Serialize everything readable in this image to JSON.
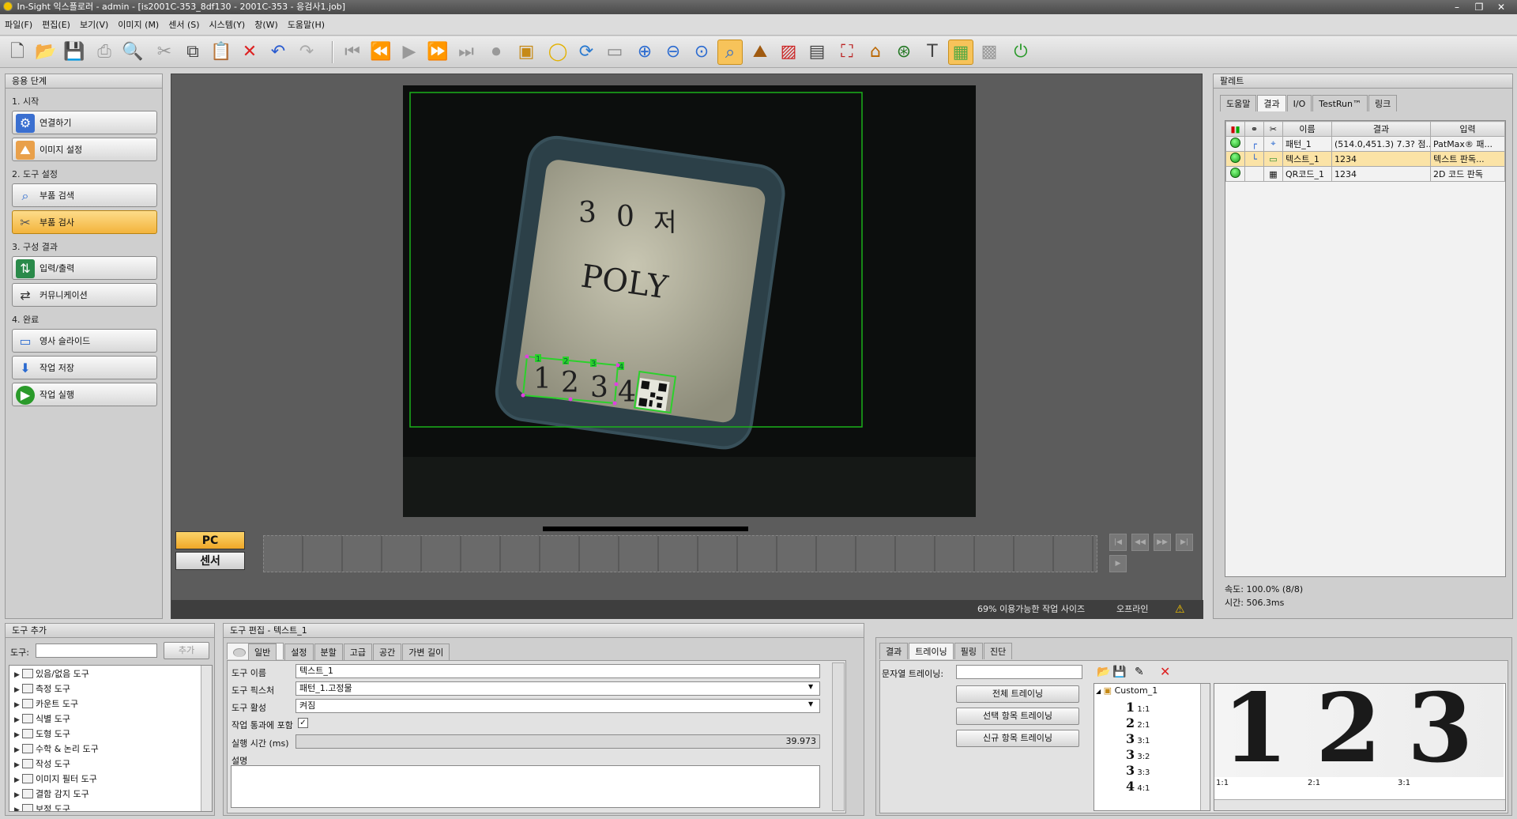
{
  "window": {
    "title": "In-Sight 익스플로러 - admin - [is2001C-353_8df130 - 2001C-353 - 응검사1.job]",
    "controls": [
      "–",
      "❐",
      "✕"
    ]
  },
  "menu": [
    "파일(F)",
    "편집(E)",
    "보기(V)",
    "이미지 (M)",
    "센서 (S)",
    "시스템(Y)",
    "창(W)",
    "도움말(H)"
  ],
  "left_panel": {
    "title": "응용 단계",
    "sections": [
      {
        "label": "1. 시작",
        "items": [
          "연결하기",
          "이미지 설정"
        ]
      },
      {
        "label": "2. 도구 설정",
        "items": [
          "부품 검색",
          "부품 검사"
        ]
      },
      {
        "label": "3. 구성 결과",
        "items": [
          "입력/출력",
          "커뮤니케이션"
        ]
      },
      {
        "label": "4. 완료",
        "items": [
          "영사 슬라이드",
          "작업 저장",
          "작업 실행"
        ]
      }
    ],
    "active_item": "부품 검사"
  },
  "viewer": {
    "image_text": {
      "line1": [
        "3",
        "0",
        "저"
      ],
      "poly": "POLY",
      "digits": [
        "1",
        "2",
        "3",
        "4"
      ],
      "roi_markers": [
        "1",
        "2",
        "3",
        "4"
      ]
    },
    "pc_button": "PC",
    "sensor_button": "센서",
    "status_text": "69% 이용가능한 작업 사이즈",
    "status_mode": "오프라인"
  },
  "palette": {
    "title": "팔레트",
    "tabs": [
      "도움말",
      "결과",
      "I/O",
      "TestRun™",
      "링크"
    ],
    "active_tab": "결과",
    "columns": [
      "이름",
      "결과",
      "입력"
    ],
    "rows": [
      {
        "name": "패턴_1",
        "result": "(514.0,451.3)  7.3? 점...",
        "input": "PatMax® 패...",
        "selected": false
      },
      {
        "name": "텍스트_1",
        "result": "1234",
        "input": "텍스트 판독...",
        "selected": true
      },
      {
        "name": "QR코드_1",
        "result": "1234",
        "input": "2D 코드 판독",
        "selected": false
      }
    ],
    "speed": "속도: 100.0% (8/8)",
    "time": "시간: 506.3ms"
  },
  "tool_add": {
    "title": "도구 추가",
    "label": "도구:",
    "button": "추가",
    "items": [
      "있음/없음 도구",
      "측정 도구",
      "카운트 도구",
      "식별 도구",
      "도형 도구",
      "수학 & 논리 도구",
      "작성 도구",
      "이미지 필터 도구",
      "결함 감지 도구",
      "보정 도구"
    ]
  },
  "tool_edit": {
    "title": "도구 편집 - 텍스트_1",
    "tabs": [
      "일반",
      "설정",
      "분할",
      "고급",
      "공간",
      "가변 길이"
    ],
    "active_tab": "일반",
    "fields": {
      "name_label": "도구 이름",
      "name_value": "텍스트_1",
      "fixture_label": "도구 픽스처",
      "fixture_value": "패턴_1.고정물",
      "enable_label": "도구 활성",
      "enable_value": "켜짐",
      "include_label": "작업 통과에 포함",
      "exec_label": "실행 시간 (ms)",
      "exec_value": "39.973",
      "desc_label": "설명"
    }
  },
  "training": {
    "tabs": [
      "결과",
      "트레이닝",
      "필링",
      "진단"
    ],
    "active_tab": "트레이닝",
    "string_label": "문자열 트레이닝:",
    "buttons": [
      "전체 트레이닝",
      "선택 항목 트레이닝",
      "신규 항목 트레이닝"
    ],
    "font_root": "Custom_1",
    "font_items": [
      {
        "glyph": "1",
        "label": "1:1"
      },
      {
        "glyph": "2",
        "label": "2:1"
      },
      {
        "glyph": "3",
        "label": "3:1"
      },
      {
        "glyph": "3",
        "label": "3:2"
      },
      {
        "glyph": "3",
        "label": "3:3"
      },
      {
        "glyph": "4",
        "label": "4:1"
      }
    ],
    "preview_chars": [
      "1",
      "2",
      "3"
    ],
    "preview_labels": [
      "1:1",
      "2:1",
      "3:1"
    ]
  },
  "colors": {
    "accent": "#f3b43c",
    "roi_green": "#2bd12b",
    "selected_row": "#fbe3a6"
  }
}
